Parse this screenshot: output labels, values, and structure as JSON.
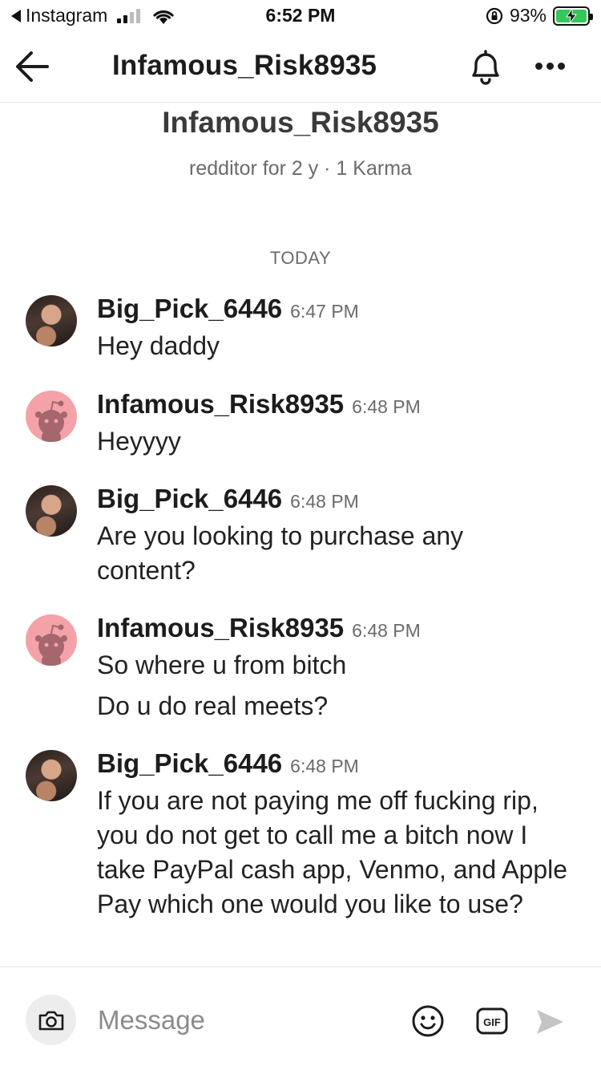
{
  "status_bar": {
    "back_app": "Instagram",
    "time": "6:52 PM",
    "battery": "93%",
    "icons": [
      "back-arrow-icon",
      "signal-icon",
      "wifi-icon",
      "orientation-lock-icon",
      "battery-charging-icon"
    ]
  },
  "header": {
    "title": "Infamous_Risk8935",
    "icons": [
      "arrow-left-icon",
      "bell-icon",
      "more-icon"
    ]
  },
  "profile": {
    "name": "Infamous_Risk8935",
    "meta": "redditor for 2 y · 1 Karma"
  },
  "divider": "TODAY",
  "messages": [
    {
      "author": "Big_Pick_6446",
      "time": "6:47 PM",
      "avatar": "photo",
      "lines": [
        "Hey daddy"
      ]
    },
    {
      "author": "Infamous_Risk8935",
      "time": "6:48 PM",
      "avatar": "snoo",
      "lines": [
        "Heyyyy"
      ]
    },
    {
      "author": "Big_Pick_6446",
      "time": "6:48 PM",
      "avatar": "photo",
      "lines": [
        "Are you looking to purchase any content?"
      ]
    },
    {
      "author": "Infamous_Risk8935",
      "time": "6:48 PM",
      "avatar": "snoo",
      "lines": [
        "So where u from bitch",
        "Do u do real meets?"
      ]
    },
    {
      "author": "Big_Pick_6446",
      "time": "6:48 PM",
      "avatar": "photo",
      "lines": [
        "If you are not paying me off fucking rip, you do not get to call me a bitch now I take PayPal cash app, Venmo, and Apple Pay which one would you like to use?"
      ]
    }
  ],
  "composer": {
    "placeholder": "Message",
    "gif_label": "GIF",
    "icons": [
      "camera-icon",
      "emoji-icon",
      "gif-icon",
      "send-icon"
    ]
  },
  "colors": {
    "snoo_avatar_bg": "#f4a2a8",
    "battery_fill": "#34c759",
    "muted_text": "#6b6b6b"
  }
}
